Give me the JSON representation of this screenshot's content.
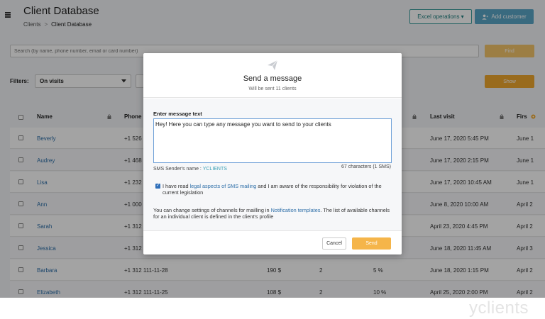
{
  "header": {
    "title": "Client Database",
    "breadcrumb_root": "Clients",
    "breadcrumb_sep": ">",
    "breadcrumb_current": "Client Database",
    "excel_label": "Excel operations ▾",
    "add_label": "Add customer"
  },
  "search": {
    "placeholder": "Search (by name, phone number, email or card number)",
    "find_label": "Find"
  },
  "filters": {
    "label": "Filters:",
    "selected": "On visits",
    "show_label": "Show"
  },
  "table": {
    "columns": {
      "name": "Name",
      "phone": "Phone",
      "last_visit": "Last visit",
      "first": "Firs"
    },
    "rows": [
      {
        "name": "Beverly",
        "phone": "+1 526",
        "amount": "",
        "visits": "",
        "discount": "",
        "last_visit": "June 17, 2020 5:45 PM",
        "first": "June 1"
      },
      {
        "name": "Audrey",
        "phone": "+1 468",
        "amount": "",
        "visits": "",
        "discount": "",
        "last_visit": "June 17, 2020 2:15 PM",
        "first": "June 1"
      },
      {
        "name": "Lisa",
        "phone": "+1 232",
        "amount": "",
        "visits": "",
        "discount": "",
        "last_visit": "June 17, 2020 10:45 AM",
        "first": "June 1"
      },
      {
        "name": "Ann",
        "phone": "+1 000",
        "amount": "",
        "visits": "",
        "discount": "",
        "last_visit": "June 8, 2020 10:00 AM",
        "first": "April 2"
      },
      {
        "name": "Sarah",
        "phone": "+1 312",
        "amount": "",
        "visits": "",
        "discount": "",
        "last_visit": "April 23, 2020 4:45 PM",
        "first": "April 2"
      },
      {
        "name": "Jessica",
        "phone": "+1 312",
        "amount": "",
        "visits": "",
        "discount": "",
        "last_visit": "June 18, 2020 11:45 AM",
        "first": "April 3"
      },
      {
        "name": "Barbara",
        "phone": "+1 312 111-11-28",
        "amount": "190 $",
        "visits": "2",
        "discount": "5 %",
        "last_visit": "June 18, 2020 1:15 PM",
        "first": "April 2"
      },
      {
        "name": "Elizabeth",
        "phone": "+1 312 111-11-25",
        "amount": "108 $",
        "visits": "2",
        "discount": "10 %",
        "last_visit": "April 25, 2020 2:00 PM",
        "first": "April 2"
      }
    ]
  },
  "modal": {
    "title": "Send a message",
    "subtitle": "Will be sent 11 clients",
    "field_label": "Enter message text",
    "message": "Hey! Here you can type any message you want to send to your clients",
    "sender_label": "SMS Sender's name :",
    "sender_name": "YCLIENTS",
    "counter": "67 characters (1 SMS)",
    "agree_1": "I have read ",
    "agree_link": "legal aspects of SMS mailing",
    "agree_2": " and I am aware of the responsibility for violation of the current legislation",
    "note_1": "You can change settings of channels for mailling in ",
    "note_link": "Notification templates",
    "note_2": ". The list of available channels for an individual client is defined in the client's profile",
    "cancel_label": "Cancel",
    "send_label": "Send"
  },
  "watermark": "yclients",
  "colors": {
    "accent": "#f5b54a",
    "teal": "#3a9d9d",
    "link": "#2d6ea8"
  }
}
